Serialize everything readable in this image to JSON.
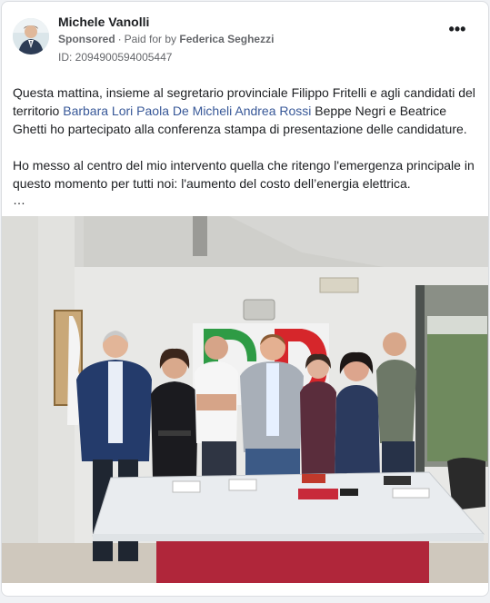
{
  "post": {
    "author_name": "Michele Vanolli",
    "sponsored_label": "Sponsored",
    "paid_for_prefix": "Paid for by",
    "payer_name": "Federica Seghezzi",
    "ad_id": "ID: 2094900594005447",
    "more_icon": "•••",
    "paragraph1": {
      "text_before": "Questa mattina, insieme al segretario provinciale Filippo Fritelli e agli candidati del territorio ",
      "links": [
        "Barbara Lori",
        "Paola De Micheli",
        "Andrea Rossi"
      ],
      "text_after": " Beppe Negri e Beatrice Ghetti ho partecipato alla conferenza stampa di presentazione delle candidature."
    },
    "paragraph2": "Ho messo al centro del mio intervento quella che ritengo l'emergenza principale in questo momento per tutti noi: l'aumento del costo dell’energia elettrica.",
    "see_more": "…"
  },
  "photo": {
    "subject": "group-photo-press-conference",
    "banner_letters": "PD",
    "colors": {
      "green": "#2e9b45",
      "red": "#d6262b",
      "table": "#e9ecef",
      "table_base": "#b0263a",
      "wall": "#ececec"
    }
  },
  "colors": {
    "link": "#385898",
    "secondary_text": "#65676b",
    "card_border": "#dadde1"
  }
}
